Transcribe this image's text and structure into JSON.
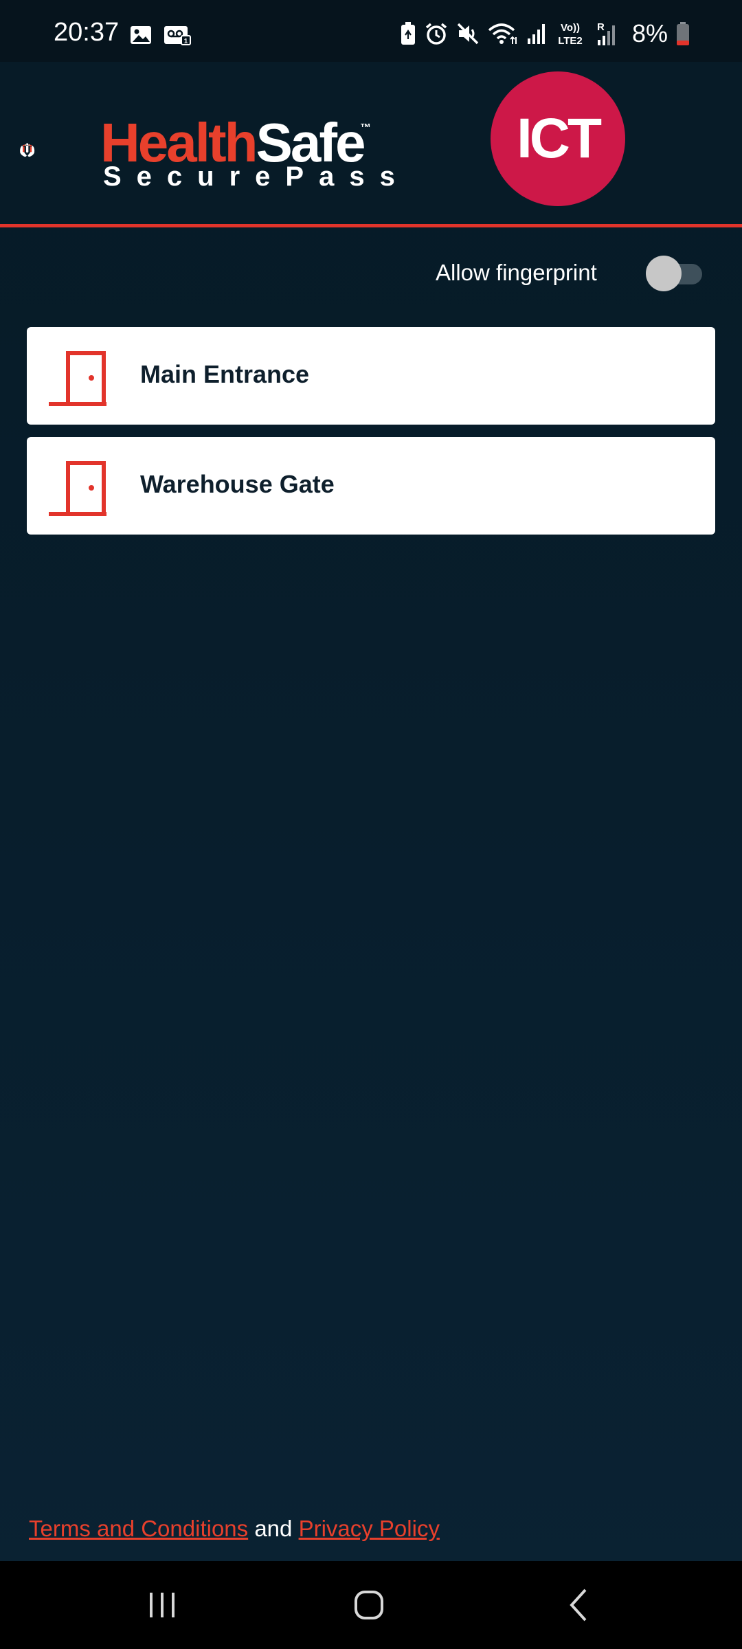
{
  "status_bar": {
    "time": "20:37",
    "left_icons": [
      "image-icon",
      "voicemail-icon"
    ],
    "right_icons": [
      "battery-saver-icon",
      "alarm-icon",
      "mute-icon",
      "wifi-icon",
      "signal-icon",
      "volte-lte2-icon",
      "signal-roaming-icon"
    ],
    "volte_label_top": "Vo))",
    "volte_label_bottom": "LTE2",
    "roaming_label": "R",
    "battery_text": "8%"
  },
  "header": {
    "brand_left_part1": "Health",
    "brand_left_part2": "Safe",
    "brand_tm": "™",
    "brand_sub": "SecurePass",
    "brand_right": "ICT"
  },
  "settings": {
    "fingerprint_label": "Allow fingerprint",
    "fingerprint_enabled": false
  },
  "doors": [
    {
      "name": "Main Entrance",
      "icon": "door-icon"
    },
    {
      "name": "Warehouse Gate",
      "icon": "door-icon"
    }
  ],
  "footer": {
    "terms": "Terms and Conditions",
    "and": " and ",
    "privacy": "Privacy Policy"
  },
  "nav": {
    "buttons": [
      "recent-apps",
      "home",
      "back"
    ]
  },
  "colors": {
    "accent": "#e2342b",
    "background": "#08202e",
    "ict_brand": "#cd1848",
    "card": "#ffffff"
  }
}
